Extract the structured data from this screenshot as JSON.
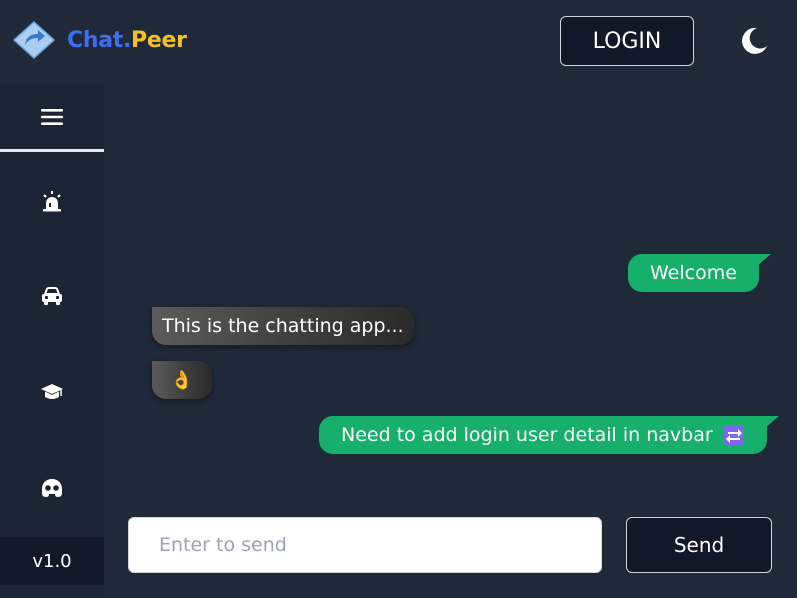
{
  "header": {
    "brand_part1": "Chat.",
    "brand_part2": "Peer",
    "login_label": "LOGIN",
    "theme_icon": "moon-icon"
  },
  "sidebar": {
    "menu_icon": "hamburger-menu-icon",
    "items": [
      {
        "icon": "siren-icon"
      },
      {
        "icon": "car-icon"
      },
      {
        "icon": "graduation-cap-icon"
      },
      {
        "icon": "gamepad-icon"
      }
    ],
    "version": "v1.0"
  },
  "messages": [
    {
      "direction": "outgoing",
      "text": "Welcome"
    },
    {
      "direction": "incoming",
      "text": "This is the chatting app..."
    },
    {
      "direction": "incoming",
      "text": "👌"
    },
    {
      "direction": "outgoing",
      "text": "Need to add login user detail in navbar",
      "icon": "swap-arrows-icon"
    }
  ],
  "composer": {
    "placeholder": "Enter to send",
    "value": "",
    "send_label": "Send"
  },
  "colors": {
    "background": "#1f2937",
    "sidebar": "#1c2533",
    "brand_blue": "#3b6ef6",
    "brand_yellow": "#f5c023",
    "outgoing_bubble": "#16b06a",
    "incoming_bubble": "#4a4a4a"
  }
}
